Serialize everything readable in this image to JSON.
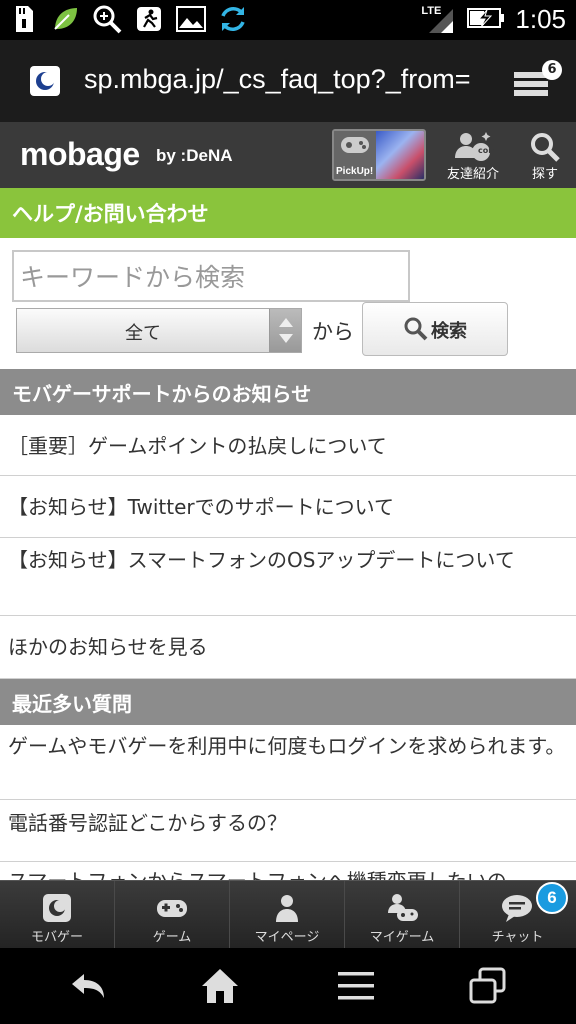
{
  "status_bar": {
    "time": "1:05",
    "network": "LTE",
    "icons": [
      "sd-card-icon",
      "leaf-icon",
      "search-app-icon",
      "runner-icon",
      "image-icon",
      "sync-icon",
      "signal-icon",
      "battery-charging-icon"
    ]
  },
  "browser": {
    "url": "sp.mbga.jp/_cs_faq_top?_from=",
    "tab_count": "6"
  },
  "header": {
    "logo": "mobage",
    "logo_by": "by :DeNA",
    "pickup_label": "PickUp!",
    "friend_invite_label": "友達紹介",
    "friend_coin": "coin",
    "search_label": "探す"
  },
  "page_title": "ヘルプ/お問い合わせ",
  "search": {
    "placeholder": "キーワードから検索",
    "scope_value": "全て",
    "from_label": "から",
    "button_label": "検索"
  },
  "sections": {
    "news": {
      "title": "モバゲーサポートからのお知らせ",
      "items": [
        "［重要］ゲームポイントの払戻しについて",
        "【お知らせ】Twitterでのサポートについて",
        "【お知らせ】スマートフォンのOSアップデートについて",
        "ほかのお知らせを見る"
      ]
    },
    "faq": {
      "title": "最近多い質問",
      "items": [
        "ゲームやモバゲーを利用中に何度もログインを求められます。",
        "電話番号認証どこからするの？",
        "スマートフォンからスマートフォンへ機種変更したいの"
      ]
    }
  },
  "bottom_nav": {
    "items": [
      "モバゲー",
      "ゲーム",
      "マイページ",
      "マイゲーム",
      "チャット"
    ],
    "chat_badge": "6"
  },
  "colors": {
    "accent_green": "#8ac43c",
    "section_gray": "#8c8c8c",
    "badge_blue": "#1a9be0"
  }
}
